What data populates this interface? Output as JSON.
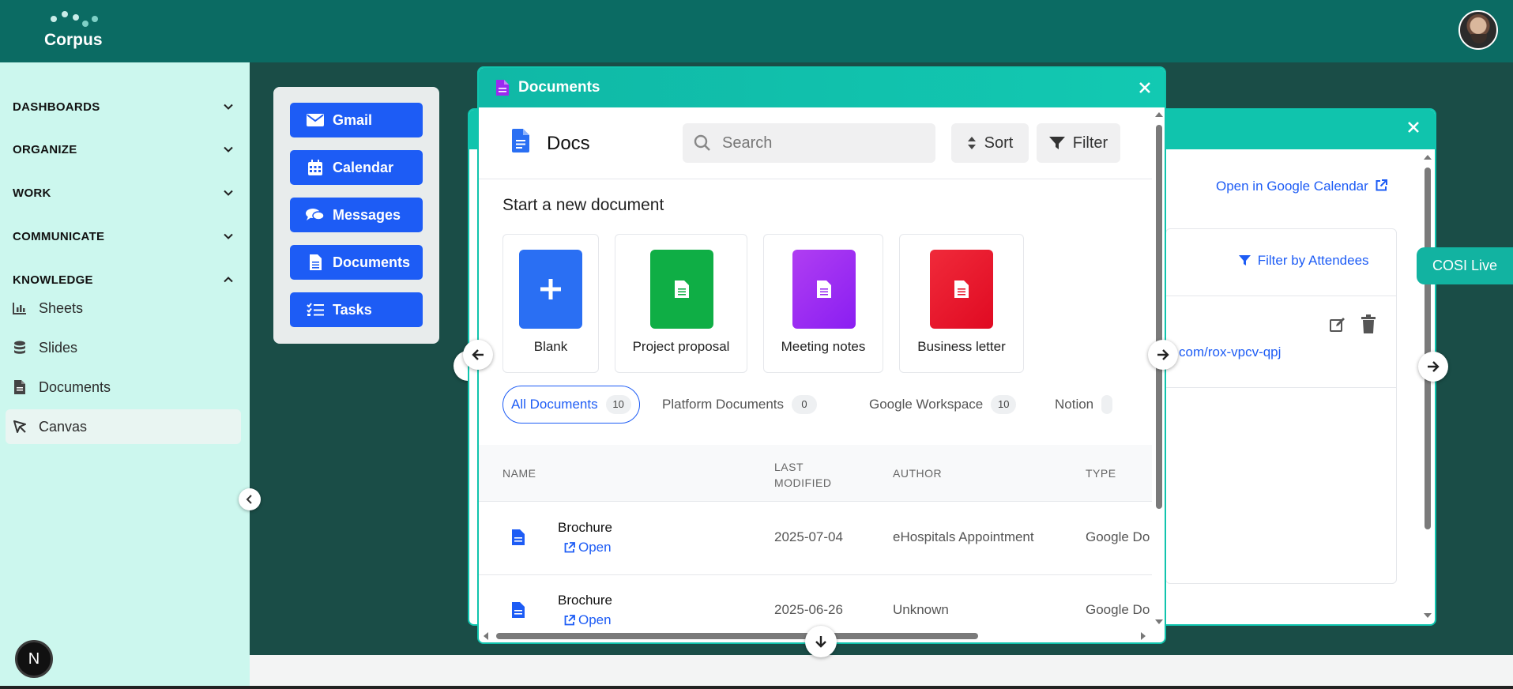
{
  "app": {
    "logo_text": "Corpus"
  },
  "sidebar": {
    "sections": [
      {
        "label": "DASHBOARDS",
        "state": "collapsed"
      },
      {
        "label": "ORGANIZE",
        "state": "collapsed"
      },
      {
        "label": "WORK",
        "state": "collapsed"
      },
      {
        "label": "COMMUNICATE",
        "state": "collapsed"
      },
      {
        "label": "KNOWLEDGE",
        "state": "expanded"
      }
    ],
    "items": [
      {
        "label": "Sheets",
        "icon": "bar-chart-icon"
      },
      {
        "label": "Slides",
        "icon": "database-icon"
      },
      {
        "label": "Documents",
        "icon": "document-icon"
      },
      {
        "label": "Canvas",
        "icon": "canvas-icon",
        "active": true
      }
    ],
    "badge": "N"
  },
  "launcher": {
    "buttons": [
      {
        "label": "Gmail",
        "icon": "envelope-icon"
      },
      {
        "label": "Calendar",
        "icon": "calendar-icon"
      },
      {
        "label": "Messages",
        "icon": "chat-icon"
      },
      {
        "label": "Documents",
        "icon": "document-icon"
      },
      {
        "label": "Tasks",
        "icon": "checklist-icon"
      }
    ]
  },
  "calendar_window": {
    "open_link": "Open in Google Calendar",
    "filter_link": "Filter by Attendees",
    "meeting_link": "com/rox-vpcv-qpj"
  },
  "cosi": {
    "label": "COSI Live"
  },
  "documents_window": {
    "title": "Documents",
    "app_title": "Docs",
    "search_placeholder": "Search",
    "sort_label": "Sort",
    "filter_label": "Filter",
    "new_heading": "Start a new document",
    "templates": [
      {
        "label": "Blank",
        "color": "#2a6ff3"
      },
      {
        "label": "Project proposal",
        "color": "#0fae45"
      },
      {
        "label": "Meeting notes",
        "color": "#9a2bf0"
      },
      {
        "label": "Business letter",
        "color": "#e5142a"
      }
    ],
    "tabs": [
      {
        "label": "All Documents",
        "count": "10",
        "active": true
      },
      {
        "label": "Platform Documents",
        "count": "0"
      },
      {
        "label": "Google Workspace",
        "count": "10"
      },
      {
        "label": "Notion",
        "count": ""
      }
    ],
    "columns": {
      "name": "NAME",
      "modified": "LAST MODIFIED",
      "author": "AUTHOR",
      "type": "TYPE"
    },
    "rows": [
      {
        "name": "Brochure",
        "open": "Open",
        "modified": "2025-07-04",
        "author": "eHospitals Appointment",
        "type": "Google Do"
      },
      {
        "name": "Brochure",
        "open": "Open",
        "modified": "2025-06-26",
        "author": "Unknown",
        "type": "Google Do"
      }
    ]
  },
  "colors": {
    "accent": "#1d5cf5",
    "teal": "#10c4ad",
    "topbar": "#0b6b63",
    "sidebar": "#ccf7ee"
  }
}
